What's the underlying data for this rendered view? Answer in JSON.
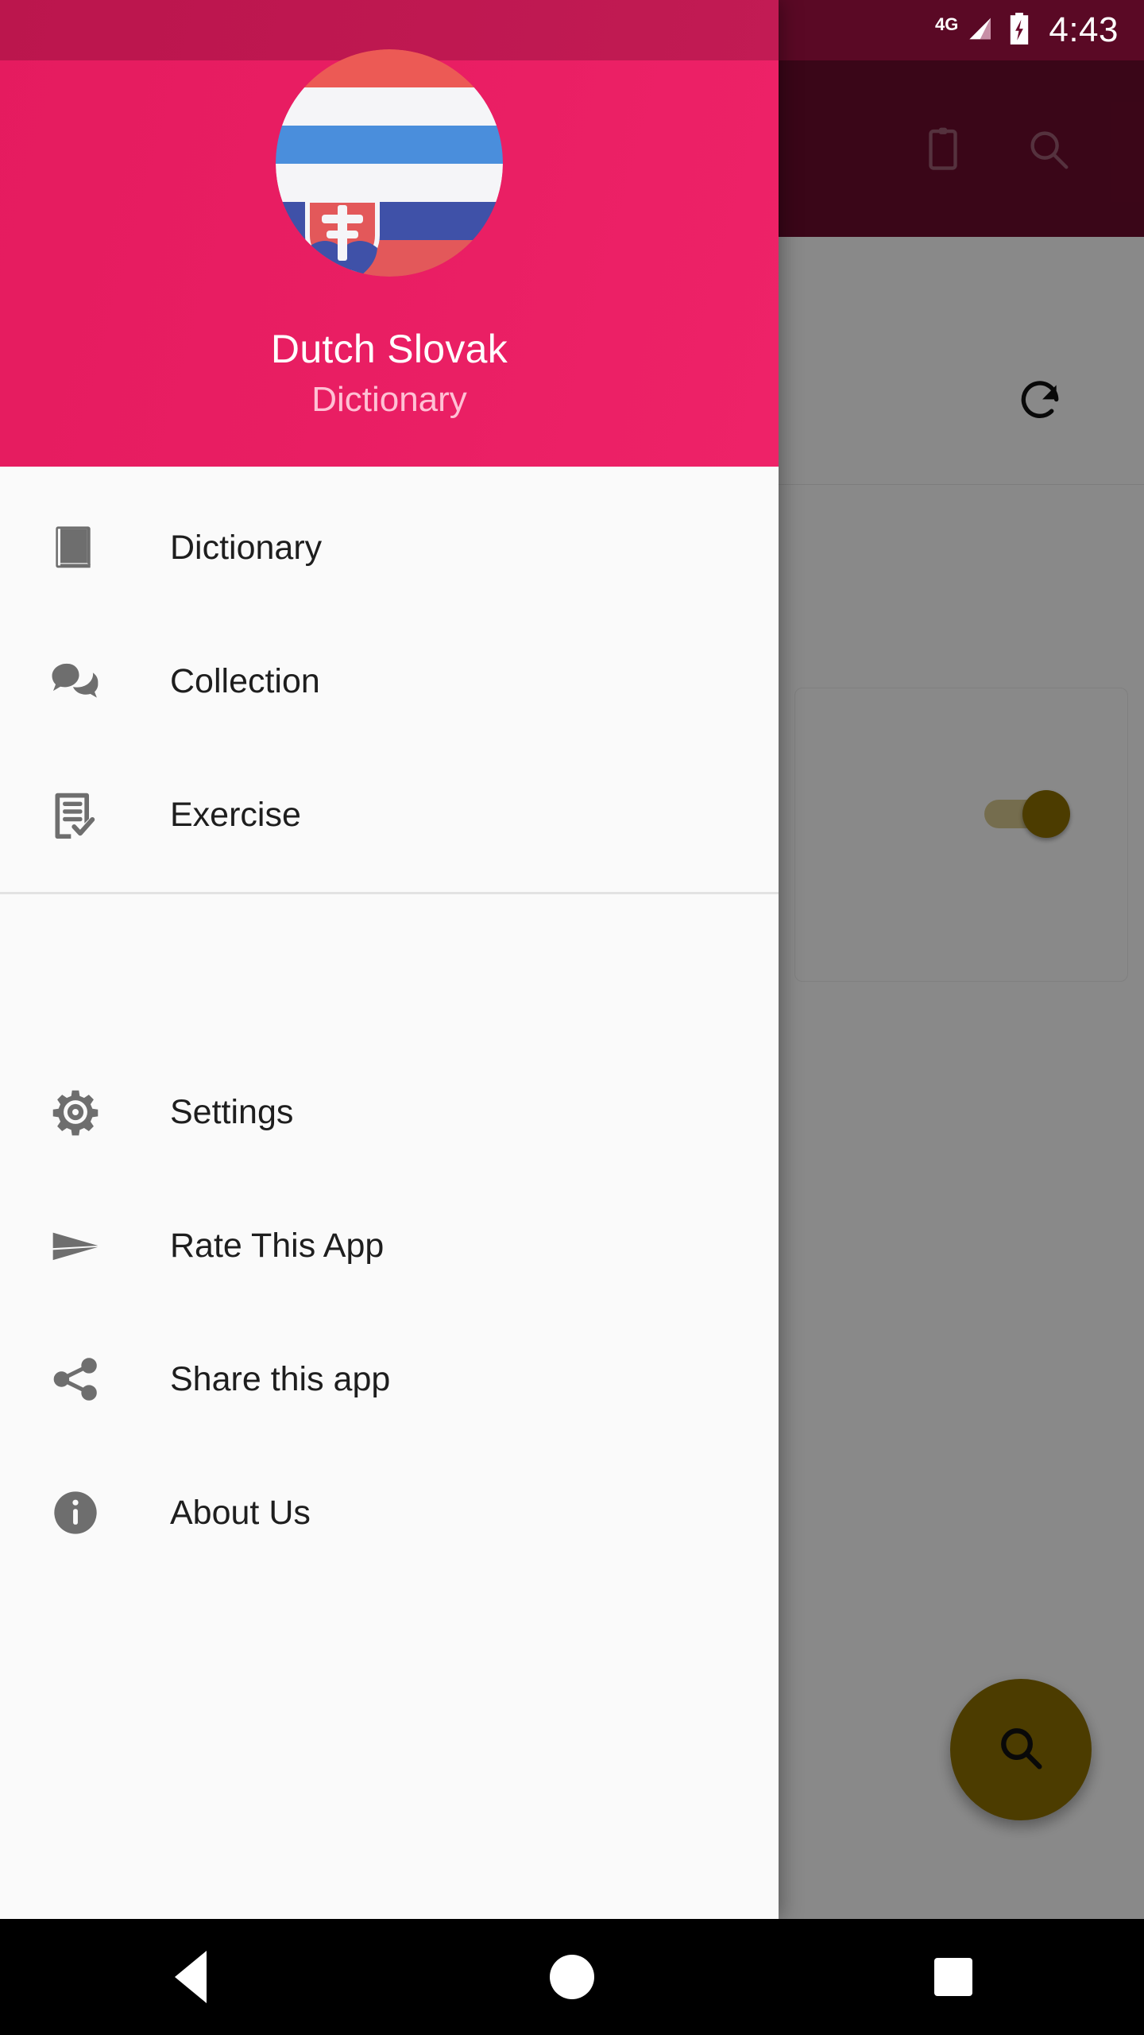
{
  "status_bar": {
    "network_label": "4G",
    "signal_icon": "signal-bars-icon",
    "battery_icon": "battery-charging-icon",
    "time": "4:43"
  },
  "app_bar": {
    "actions": [
      {
        "name": "clipboard-icon",
        "label": "Clipboard"
      },
      {
        "name": "search-icon",
        "label": "Search"
      }
    ]
  },
  "content": {
    "refresh_icon": "refresh-icon",
    "toggle": {
      "name": "settings-toggle",
      "state": "on"
    },
    "fab": {
      "icon": "search-icon",
      "label": "Search",
      "color": "#8A6D00"
    }
  },
  "drawer": {
    "avatar": {
      "name": "dutch-slovak-flag-avatar",
      "top_flag": "Netherlands",
      "bottom_flag": "Slovakia",
      "colors": {
        "dutch_red": "#EC5A55",
        "dutch_white": "#F5F5F8",
        "dutch_blue": "#4A8EDC",
        "slovak_white": "#F5F5F8",
        "slovak_blue": "#3F51A8",
        "shield_red": "#E3585A"
      }
    },
    "title": "Dutch  Slovak",
    "subtitle": "Dictionary",
    "header_color": "#E91E63",
    "menu_group_primary": [
      {
        "icon": "book-icon",
        "label": "Dictionary"
      },
      {
        "icon": "chat-bubbles-icon",
        "label": "Collection"
      },
      {
        "icon": "document-check-icon",
        "label": "Exercise"
      }
    ],
    "menu_group_secondary": [
      {
        "icon": "gear-icon",
        "label": "Settings"
      },
      {
        "icon": "send-icon",
        "label": "Rate This App"
      },
      {
        "icon": "share-icon",
        "label": "Share this app"
      },
      {
        "icon": "info-circle-icon",
        "label": "About Us"
      }
    ]
  },
  "nav_bar": {
    "back": "back-button",
    "home": "home-button",
    "recents": "recents-button"
  }
}
